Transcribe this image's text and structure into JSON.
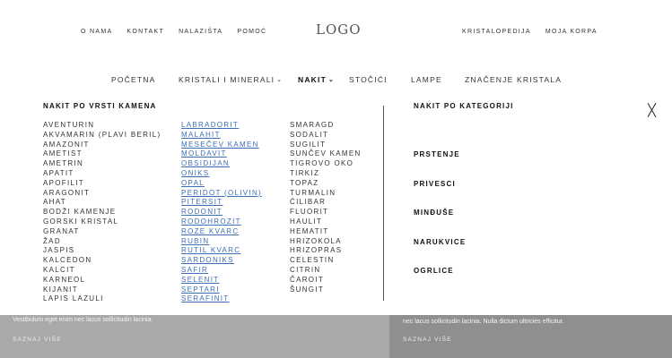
{
  "top_nav": {
    "left": [
      "O NAMA",
      "KONTAKT",
      "NALAZIŠTA",
      "POMOĆ"
    ],
    "logo": "LOGO",
    "right": [
      "KRISTALOPEDIJA",
      "MOJA KORPA"
    ]
  },
  "main_nav": {
    "items": [
      "POČETNA",
      "KRISTALI I MINERALI",
      "NAKIT",
      "STOČIĆI",
      "LAMPE",
      "ZNAČENJE KRISTALA"
    ],
    "active": "NAKIT"
  },
  "mega_menu": {
    "stone_section_title": "NAKIT PO VRSTI KAMENA",
    "column1": [
      "AVENTURIN",
      "AKVAMARIN (PLAVI BERIL)",
      "AMAZONIT",
      "AMETIST",
      "AMETRIN",
      "APATIT",
      "APOFILIT",
      "ARAGONIT",
      "AHAT",
      "BODŽI KAMENJE",
      "GORSKI KRISTAL",
      "GRANAT",
      "ŽAD",
      "JASPIS",
      "KALCEDON",
      "KALCIT",
      "KARNEOL",
      "KIJANIT",
      "LAPIS LAZULI"
    ],
    "column2": [
      "LABRADORIT",
      "MALAHIT",
      "MESEČEV KAMEN",
      "MOLDAVIT",
      "OBSIDIJAN",
      "ONIKS",
      "OPAL",
      "PERIDOT (OLIVIN)",
      "PITERSIT",
      "RODONIT",
      "RODOHROZIT",
      "ROZE KVARC",
      "RUBIN",
      "RUTIL KVARC",
      "SARDONIKS",
      "SAFIR",
      "SELENIT",
      "SEPTARI",
      "SERAFINIT"
    ],
    "column3": [
      "SMARAGD",
      "SODALIT",
      "SUGILIT",
      "SUNČEV KAMEN",
      "TIGROVO OKO",
      "TIRKIZ",
      "TOPAZ",
      "TURMALIN",
      "ĆILIBAR",
      "FLUORIT",
      "HAULIT",
      "HEMATIT",
      "HRIZOKOLA",
      "HRIZOPRAS",
      "CELESTIN",
      "CITRIN",
      "ČAROIT",
      "ŠUNGIT"
    ],
    "category_section_title": "NAKIT PO KATEGORIJI",
    "categories": [
      "PRSTENJE",
      "PRIVESCI",
      "MINĐUŠE",
      "NARUKVICE",
      "OGRLICE"
    ]
  },
  "hero": {
    "left_text": "Vestibulum eget enim nec lacus sollicitudin lacinia.",
    "left_link": "SAZNAJ VIŠE",
    "right_text": "nec lacus sollicitudin lacinia. Nulla dictum ultricies efficitur.",
    "right_link": "SAZNAJ VIŠE"
  },
  "colors": {
    "link_blue": "#3b6fb6",
    "hero_left_bg": "#a9a9a9",
    "hero_right_bg": "#8f8f8f"
  },
  "icons": {
    "close": "close-icon",
    "nav_dropdown": "chevron-down-icon"
  }
}
